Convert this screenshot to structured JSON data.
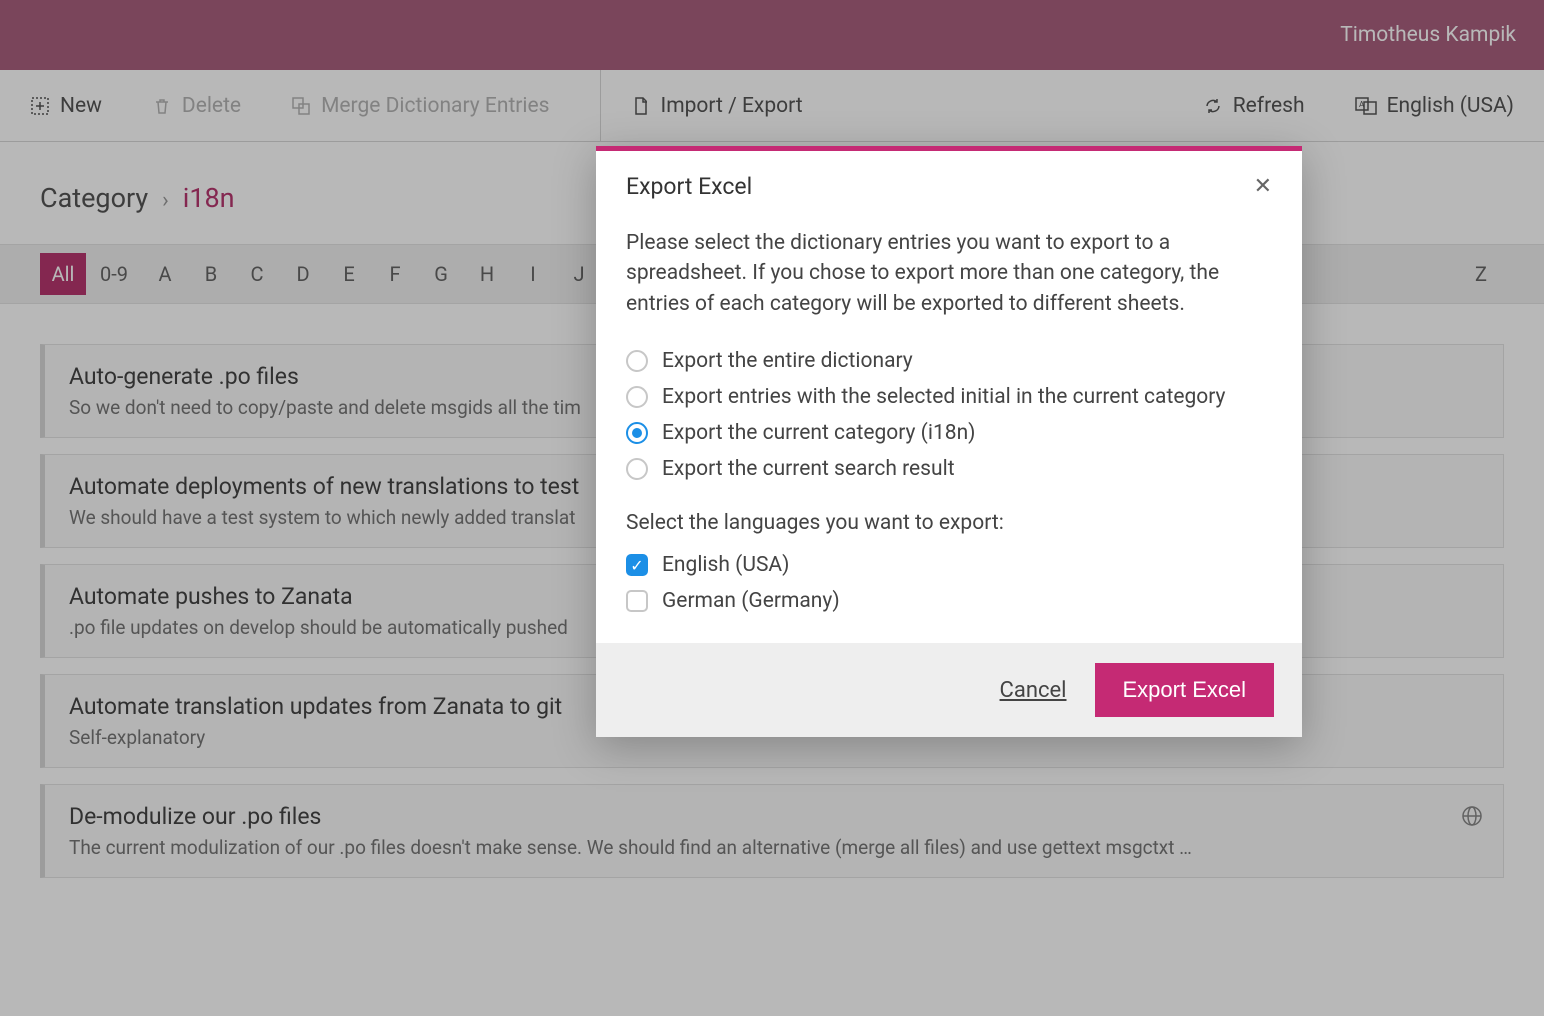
{
  "topbar": {
    "user": "Timotheus Kampik"
  },
  "toolbar": {
    "new": "New",
    "delete": "Delete",
    "merge": "Merge Dictionary Entries",
    "import_export": "Import / Export",
    "refresh": "Refresh",
    "language": "English (USA)"
  },
  "breadcrumb": {
    "root": "Category",
    "current": "i18n"
  },
  "alpha": {
    "all": "All",
    "digits": "0-9",
    "letters": [
      "A",
      "B",
      "C",
      "D",
      "E",
      "F",
      "G",
      "H",
      "I",
      "J"
    ],
    "last": "Z",
    "active": "All"
  },
  "entries": [
    {
      "title": "Auto-generate .po files",
      "desc": "So we don't need to copy/paste and delete msgids all the tim",
      "globe": false
    },
    {
      "title": "Automate deployments of new translations to test",
      "desc": "We should have a test system to which newly added translat",
      "globe": false
    },
    {
      "title": "Automate pushes to Zanata",
      "desc": ".po file updates on develop should be automatically pushed",
      "globe": false
    },
    {
      "title": "Automate translation updates from Zanata to git",
      "desc": "Self-explanatory",
      "globe": false
    },
    {
      "title": "De-modulize our .po files",
      "desc": "The current modulization of our .po files doesn't make sense. We should find an alternative (merge all files) and use gettext msgctxt …",
      "globe": true
    }
  ],
  "modal": {
    "title": "Export Excel",
    "intro": "Please select the dictionary entries you want to export to a spreadsheet. If you chose to export more than one category, the entries of each category will be exported to different sheets.",
    "options": [
      {
        "label": "Export the entire dictionary",
        "selected": false
      },
      {
        "label": "Export entries with the selected initial in the current category",
        "selected": false
      },
      {
        "label": "Export the current category (i18n)",
        "selected": true
      },
      {
        "label": "Export the current search result",
        "selected": false
      }
    ],
    "lang_label": "Select the languages you want to export:",
    "languages": [
      {
        "label": "English (USA)",
        "checked": true
      },
      {
        "label": "German (Germany)",
        "checked": false
      }
    ],
    "cancel": "Cancel",
    "submit": "Export Excel"
  }
}
